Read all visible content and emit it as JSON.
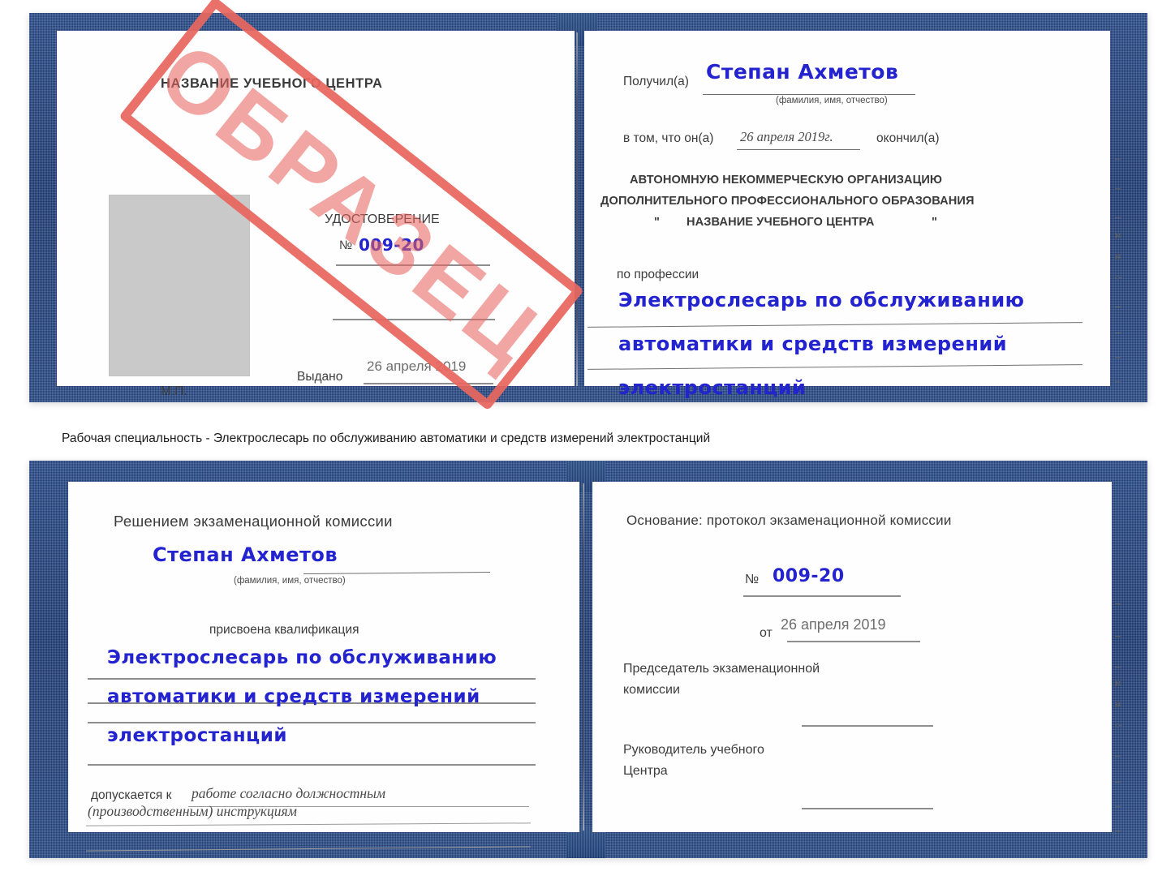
{
  "caption": {
    "text": "Рабочая специальность - Электрослесарь по обслуживанию автоматики и средств измерений электростанций"
  },
  "watermark": {
    "label": "ОБРАЗЕЦ",
    "color": "#e8675f"
  },
  "colors": {
    "cover_blue": "#254a8a",
    "handwriting_blue": "#2323cf",
    "stamp_red": "#e8675f",
    "paper_white": "#fefefe",
    "photo_gray": "#c9c9c9"
  },
  "certificate_top": {
    "left_page": {
      "title": "НАЗВАНИЕ УЧЕБНОГО ЦЕНТРА",
      "doc_type": "УДОСТОВЕРЕНИЕ",
      "number_prefix": "№",
      "number_value": "009-20",
      "issued_label": "Выдано",
      "issued_value": "26 апреля 2019",
      "seal_label": "М.П.",
      "photo_placeholder": "photo-placeholder"
    },
    "right_page": {
      "received_label": "Получил(а)",
      "received_value": "Степан Ахметов",
      "name_hint": "(фамилия, имя, отчество)",
      "that_he_label": "в том, что он(а)",
      "completion_date": "26 апреля 2019г.",
      "finished_label": "окончил(а)",
      "org_line1": "АВТОНОМНУЮ НЕКОММЕРЧЕСКУЮ ОРГАНИЗАЦИЮ",
      "org_line2": "ДОПОЛНИТЕЛЬНОГО ПРОФЕССИОНАЛЬНОГО ОБРАЗОВАНИЯ",
      "org_quote_open": "\"",
      "org_line3": "НАЗВАНИЕ УЧЕБНОГО ЦЕНТРА",
      "org_quote_close": "\"",
      "profession_label": "по профессии",
      "profession_line1": "Электрослесарь по обслуживанию",
      "profession_line2": "автоматики и средств измерений",
      "profession_line3": "электростанций",
      "bleed_marks": [
        "–",
        "–",
        "–",
        "и",
        "а",
        "‹-",
        "–",
        "–",
        "–",
        "–"
      ]
    }
  },
  "certificate_bottom": {
    "left_page": {
      "heading": "Решением экзаменационной комиссии",
      "name_value": "Степан Ахметов",
      "name_hint": "(фамилия, имя, отчество)",
      "qualification_label": "присвоена квалификация",
      "qualification_line1": "Электрослесарь по обслуживанию",
      "qualification_line2": "автоматики и средств измерений",
      "qualification_line3": "электростанций",
      "admitted_label": "допускается к",
      "admitted_value_line1": "работе согласно должностным",
      "admitted_value_line2": "(производственным) инструкциям"
    },
    "right_page": {
      "basis_label": "Основание: протокол экзаменационной комиссии",
      "number_prefix": "№",
      "number_value": "009-20",
      "date_prefix": "от",
      "date_value": "26 апреля 2019",
      "chairman_line1": "Председатель экзаменационной",
      "chairman_line2": "комиссии",
      "head_line1": "Руководитель учебного",
      "head_line2": "Центра",
      "bleed_marks": [
        "–",
        "–",
        "–",
        "и",
        "а",
        "‹-",
        "–",
        "–",
        "–",
        "–"
      ]
    }
  }
}
